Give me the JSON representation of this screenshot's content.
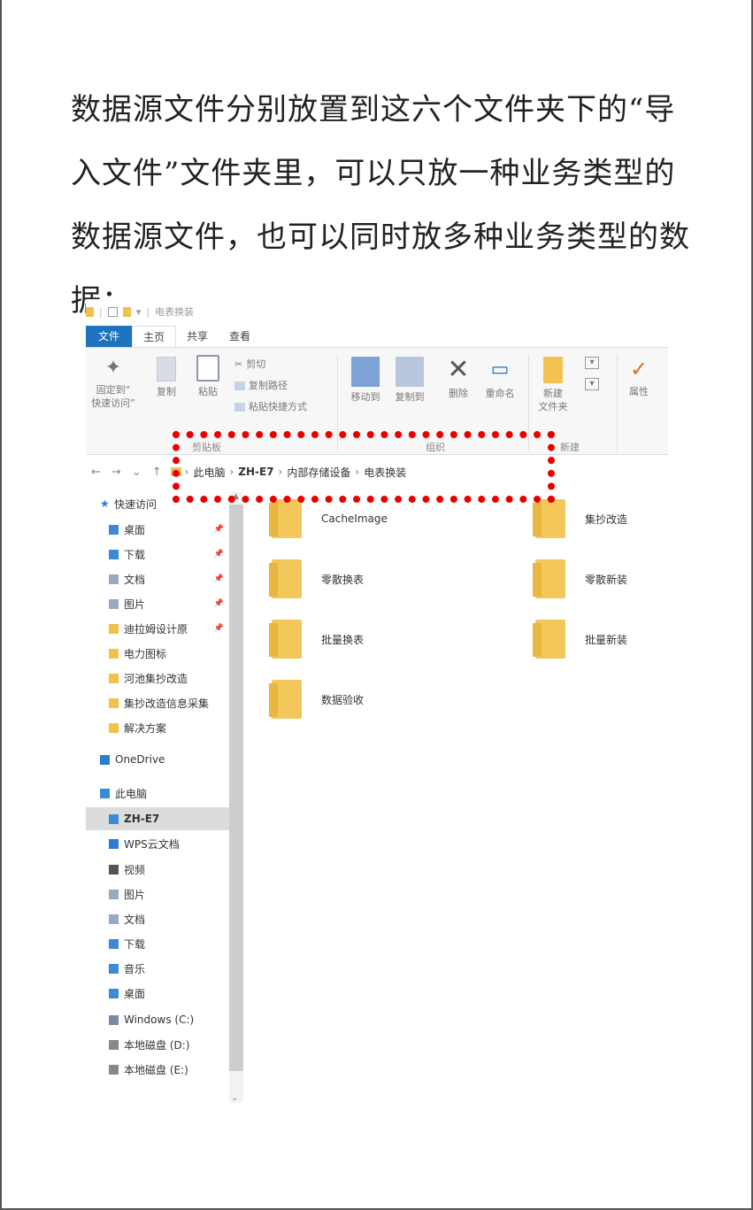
{
  "doc": {
    "lines": [
      "数据源文件分别放置到这六个文件夹下的“导",
      "入文件”文件夹里，可以只放一种业务类型的",
      "数据源文件，也可以同时放多种业务类型的数",
      "据；"
    ]
  },
  "explorer": {
    "window_title": "电表换装",
    "tabs": [
      "文件",
      "主页",
      "共享",
      "查看"
    ],
    "ribbon": {
      "pin_label_1": "固定到“",
      "pin_label_2": "快速访问”",
      "copy": "复制",
      "paste": "粘贴",
      "cut": "剪切",
      "copy_path": "复制路径",
      "paste_shortcut": "粘贴快捷方式",
      "move_to": "移动到",
      "copy_to": "复制到",
      "delete": "删除",
      "rename": "重命名",
      "new_folder_1": "新建",
      "new_folder_2": "文件夹",
      "properties": "属性",
      "group_clipboard": "剪贴板",
      "group_organize": "组织",
      "group_new": "新建"
    },
    "address": {
      "back": "←",
      "forward": "→",
      "recent": "⌄",
      "up": "↑",
      "crumbs": [
        "此电脑",
        "ZH-E7",
        "内部存储设备",
        "电表换装"
      ]
    },
    "nav": [
      {
        "label": "快速访问",
        "icon": "star-icon",
        "color": "#2b7cd3"
      },
      {
        "label": "桌面",
        "icon": "desktop-folder-icon",
        "color": "#3a8ad6",
        "pinned": true
      },
      {
        "label": "下载",
        "icon": "download-folder-icon",
        "color": "#3a8ad6",
        "pinned": true
      },
      {
        "label": "文档",
        "icon": "documents-folder-icon",
        "color": "#9aa9c2",
        "pinned": true
      },
      {
        "label": "图片",
        "icon": "pictures-folder-icon",
        "color": "#9aa9c2",
        "pinned": true
      },
      {
        "label": "迪拉姆设计原",
        "icon": "folder-icon",
        "color": "#f1c24b",
        "pinned": true
      },
      {
        "label": "电力图标",
        "icon": "folder-icon",
        "color": "#f1c24b"
      },
      {
        "label": "河池集抄改造",
        "icon": "folder-icon",
        "color": "#f1c24b"
      },
      {
        "label": "集抄改造信息采集",
        "icon": "folder-icon",
        "color": "#f1c24b"
      },
      {
        "label": "解决方案",
        "icon": "folder-icon",
        "color": "#f1c24b"
      },
      {
        "label": "OneDrive",
        "icon": "onedrive-icon",
        "color": "#2b7cd3"
      },
      {
        "label": "此电脑",
        "icon": "this-pc-icon",
        "color": "#3a8ad6"
      },
      {
        "label": "ZH-E7",
        "icon": "device-icon",
        "color": "#3a8ad6",
        "selected": true
      },
      {
        "label": "WPS云文档",
        "icon": "cloud-icon",
        "color": "#2b7cd3"
      },
      {
        "label": "视频",
        "icon": "videos-folder-icon",
        "color": "#555"
      },
      {
        "label": "图片",
        "icon": "pictures-folder-icon",
        "color": "#9aa9c2"
      },
      {
        "label": "文档",
        "icon": "documents-folder-icon",
        "color": "#9aa9c2"
      },
      {
        "label": "下载",
        "icon": "download-folder-icon",
        "color": "#3a8ad6"
      },
      {
        "label": "音乐",
        "icon": "music-folder-icon",
        "color": "#3a8ad6"
      },
      {
        "label": "桌面",
        "icon": "desktop-folder-icon",
        "color": "#3a8ad6"
      },
      {
        "label": "Windows (C:)",
        "icon": "windows-drive-icon",
        "color": "#7a8aa3"
      },
      {
        "label": "本地磁盘 (D:)",
        "icon": "drive-icon",
        "color": "#888"
      },
      {
        "label": "本地磁盘 (E:)",
        "icon": "drive-icon",
        "color": "#888"
      }
    ],
    "folders": [
      {
        "name": "CacheImage"
      },
      {
        "name": "集抄改造"
      },
      {
        "name": "零散换表"
      },
      {
        "name": "零散新装"
      },
      {
        "name": "批量换表"
      },
      {
        "name": "批量新装"
      },
      {
        "name": "数据验收"
      }
    ]
  }
}
